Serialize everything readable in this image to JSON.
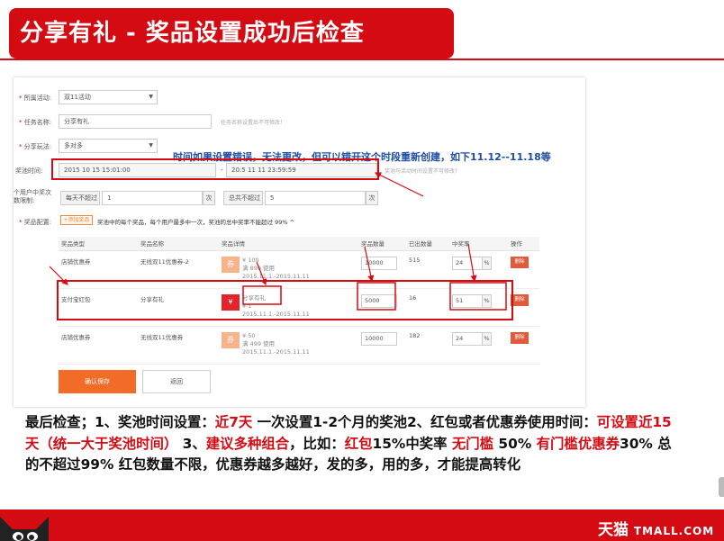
{
  "slide": {
    "title": "分享有礼 - 奖品设置成功后检查"
  },
  "form": {
    "activity_label": "所属活动:",
    "activity_value": "双11活动",
    "task_label": "任务名称:",
    "task_value": "分享有礼",
    "task_hint": "任务名称设置后不可修改！",
    "play_label": "分享玩法:",
    "play_value": "多对多",
    "time_label": "奖池时间:",
    "time_start": "2015 10 15 15:01:00",
    "time_sep": "-",
    "time_end": "20:5 11 11 23:59:59",
    "time_hint": "奖池与活动时间设置不可修改！",
    "limit_label": "个用户中奖次数限制:",
    "daily_label": "每天不超过",
    "daily_value": "1",
    "daily_unit": "次",
    "total_label": "总共不超过",
    "total_value": "5",
    "total_unit": "次",
    "prize_label": "奖品配置:",
    "add_button": "+添加奖品",
    "pool_note": "奖池中的每个奖品，每个用户最多中一次，奖池的总中奖率不能超过 99% ^"
  },
  "annotation": {
    "blue_note": "时间如果设置错误，无法更改，但可以错开这个时段重新创建，如下11.12--11.18等"
  },
  "table": {
    "headers": [
      "奖品类型",
      "奖品名称",
      "奖品详情",
      "奖品数量",
      "已出数量",
      "中奖率",
      "操作"
    ],
    "rows": [
      {
        "type": "店铺优惠券",
        "name": "无线双11优惠券-2",
        "thumb": "券",
        "detail": [
          "¥ 100",
          "满 899 使用",
          "2015.11.1.-2015.11.11"
        ],
        "qty": "10000",
        "issued": "515",
        "rate": "24",
        "pct": "%",
        "op": "删除"
      },
      {
        "type": "支付宝红包",
        "name": "分享有礼",
        "thumb": "¥",
        "detail": [
          "分享有礼",
          "¥ 1",
          "2015.11.1.-2015.11.11"
        ],
        "qty": "5000",
        "issued": "16",
        "rate": "51",
        "pct": "%",
        "op": "删除"
      },
      {
        "type": "店铺优惠券",
        "name": "无线双11优惠券",
        "thumb": "券",
        "detail": [
          "¥ 50",
          "满 499 使用",
          "2015.11.1.-2015.11.11"
        ],
        "qty": "10000",
        "issued": "182",
        "rate": "24",
        "pct": "%",
        "op": "删除"
      }
    ]
  },
  "buttons": {
    "save": "确认保存",
    "back": "返回"
  },
  "summary": {
    "p1": "最后检查；1、奖池时间设置：",
    "r1": "近7天",
    "p2": "  一次设置1-2个月的奖池2、红包或者优惠券使用时间：",
    "r2": "可设置近15天（统一大于奖池时间）",
    "p3": "  3、",
    "r3": "建议多种组合",
    "p4": "，比如：",
    "r4": "红包",
    "p5": "15%中奖率  ",
    "r5": "无门槛",
    "p6": " 50% ",
    "r6": "有门槛优惠券",
    "p7": "30% 总的不超过99%  红包数量不限，优惠券越多越好，发的多，用的多，才能提高转化"
  },
  "footer": {
    "brand_cn": "天猫",
    "brand_en": "TMALL.COM"
  },
  "colors": {
    "brand_red": "#d40b12",
    "annotation_blue": "#1f4ea8",
    "save_orange": "#f26b27"
  }
}
